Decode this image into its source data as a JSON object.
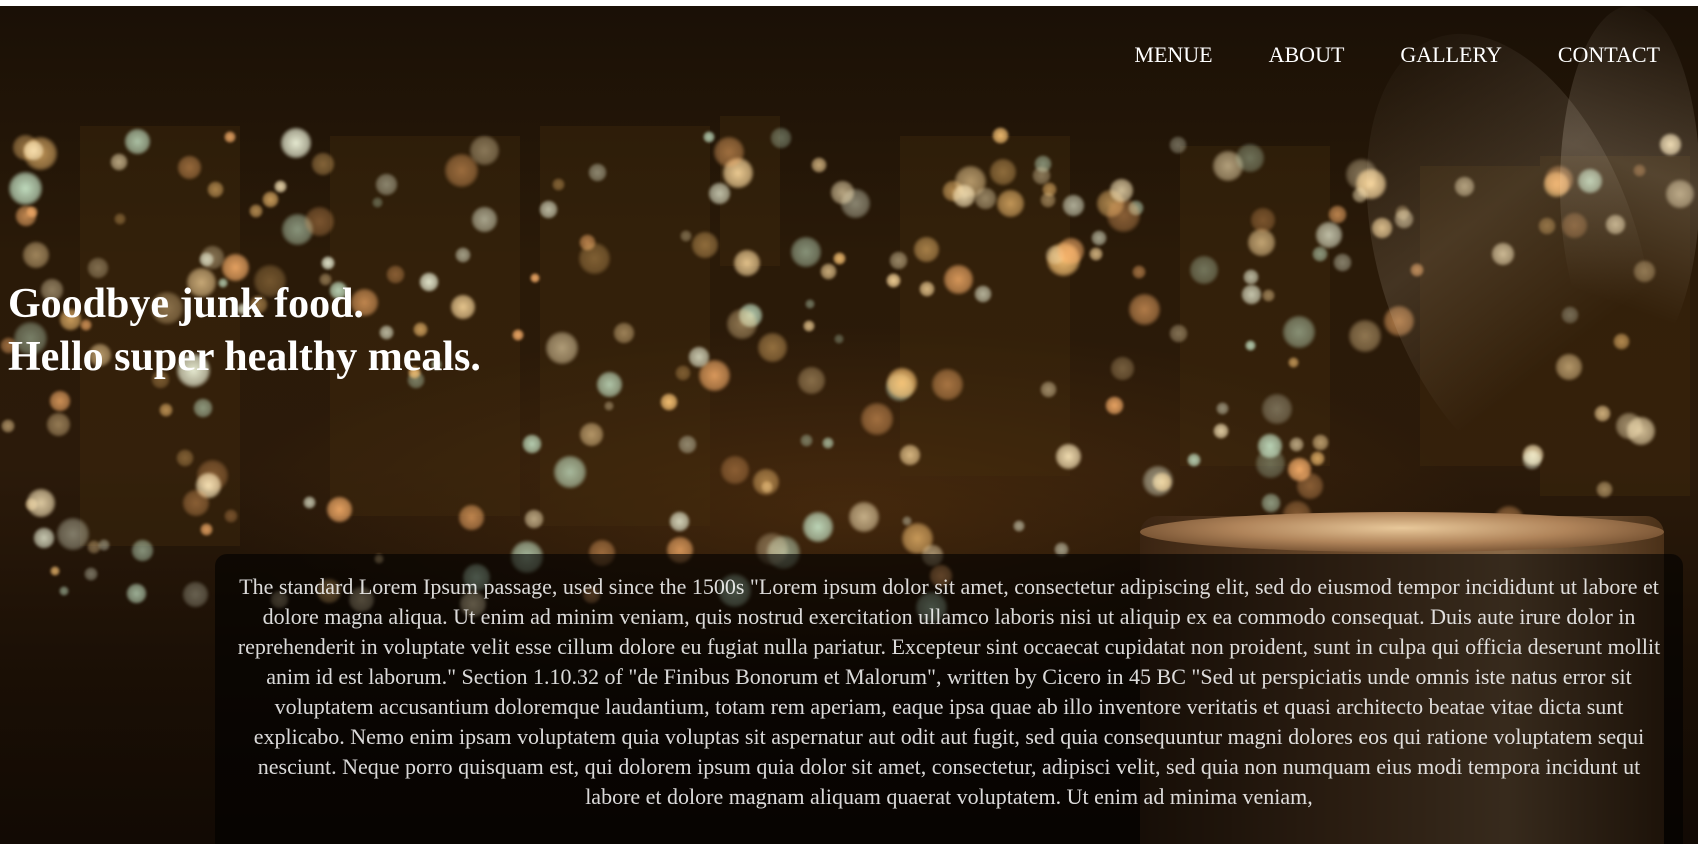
{
  "nav": {
    "items": [
      "MENUE",
      "ABOUT",
      "GALLERY",
      "CONTACT"
    ]
  },
  "hero": {
    "line1": "Goodbye junk food.",
    "line2": "Hello super healthy meals."
  },
  "content": {
    "paragraph": "The standard Lorem Ipsum passage, used since the 1500s \"Lorem ipsum dolor sit amet, consectetur adipiscing elit, sed do eiusmod tempor incididunt ut labore et dolore magna aliqua. Ut enim ad minim veniam, quis nostrud exercitation ullamco laboris nisi ut aliquip ex ea commodo consequat. Duis aute irure dolor in reprehenderit in voluptate velit esse cillum dolore eu fugiat nulla pariatur. Excepteur sint occaecat cupidatat non proident, sunt in culpa qui officia deserunt mollit anim id est laborum.\" Section 1.10.32 of \"de Finibus Bonorum et Malorum\", written by Cicero in 45 BC \"Sed ut perspiciatis unde omnis iste natus error sit voluptatem accusantium doloremque laudantium, totam rem aperiam, eaque ipsa quae ab illo inventore veritatis et quasi architecto beatae vitae dicta sunt explicabo. Nemo enim ipsam voluptatem quia voluptas sit aspernatur aut odit aut fugit, sed quia consequuntur magni dolores eos qui ratione voluptatem sequi nesciunt. Neque porro quisquam est, qui dolorem ipsum quia dolor sit amet, consectetur, adipisci velit, sed quia non numquam eius modi tempora incidunt ut labore et dolore magnam aliquam quaerat voluptatem. Ut enim ad minima veniam,"
  },
  "colors": {
    "text": "#ffffff",
    "panel": "#000000",
    "background": "#2a1a08"
  }
}
